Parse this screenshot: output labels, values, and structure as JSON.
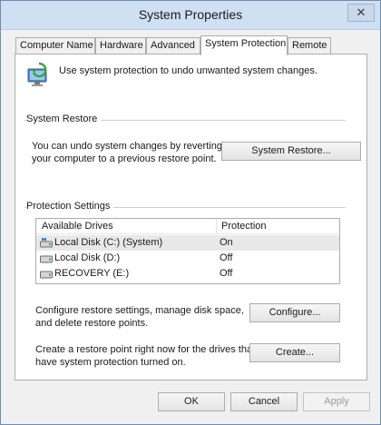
{
  "window": {
    "title": "System Properties",
    "close_glyph": "✕"
  },
  "tabs": [
    {
      "label": "Computer Name",
      "active": false
    },
    {
      "label": "Hardware",
      "active": false
    },
    {
      "label": "Advanced",
      "active": false
    },
    {
      "label": "System Protection",
      "active": true
    },
    {
      "label": "Remote",
      "active": false
    }
  ],
  "intro": {
    "text": "Use system protection to undo unwanted system changes.",
    "icon": "system-protection-icon"
  },
  "system_restore": {
    "heading": "System Restore",
    "line1": "You can undo system changes by reverting",
    "line2": "your computer to a previous restore point.",
    "button": "System Restore..."
  },
  "protection": {
    "heading": "Protection Settings",
    "columns": [
      "Available Drives",
      "Protection"
    ],
    "drives": [
      {
        "name": "Local Disk (C:) (System)",
        "protection": "On",
        "icon": "system-drive-icon",
        "selected": true
      },
      {
        "name": "Local Disk (D:)",
        "protection": "Off",
        "icon": "drive-icon",
        "selected": false
      },
      {
        "name": "RECOVERY (E:)",
        "protection": "Off",
        "icon": "drive-icon",
        "selected": false
      }
    ],
    "configure_line1": "Configure restore settings, manage disk space,",
    "configure_line2": "and delete restore points.",
    "configure_button": "Configure...",
    "create_line1": "Create a restore point right now for the drives that",
    "create_line2": "have system protection turned on.",
    "create_button": "Create..."
  },
  "footer": {
    "ok": "OK",
    "cancel": "Cancel",
    "apply": "Apply"
  },
  "colors": {
    "titlebar": "#cfe0f3",
    "window_border": "#6f8cb0",
    "selected_row": "#e8e8e8"
  }
}
